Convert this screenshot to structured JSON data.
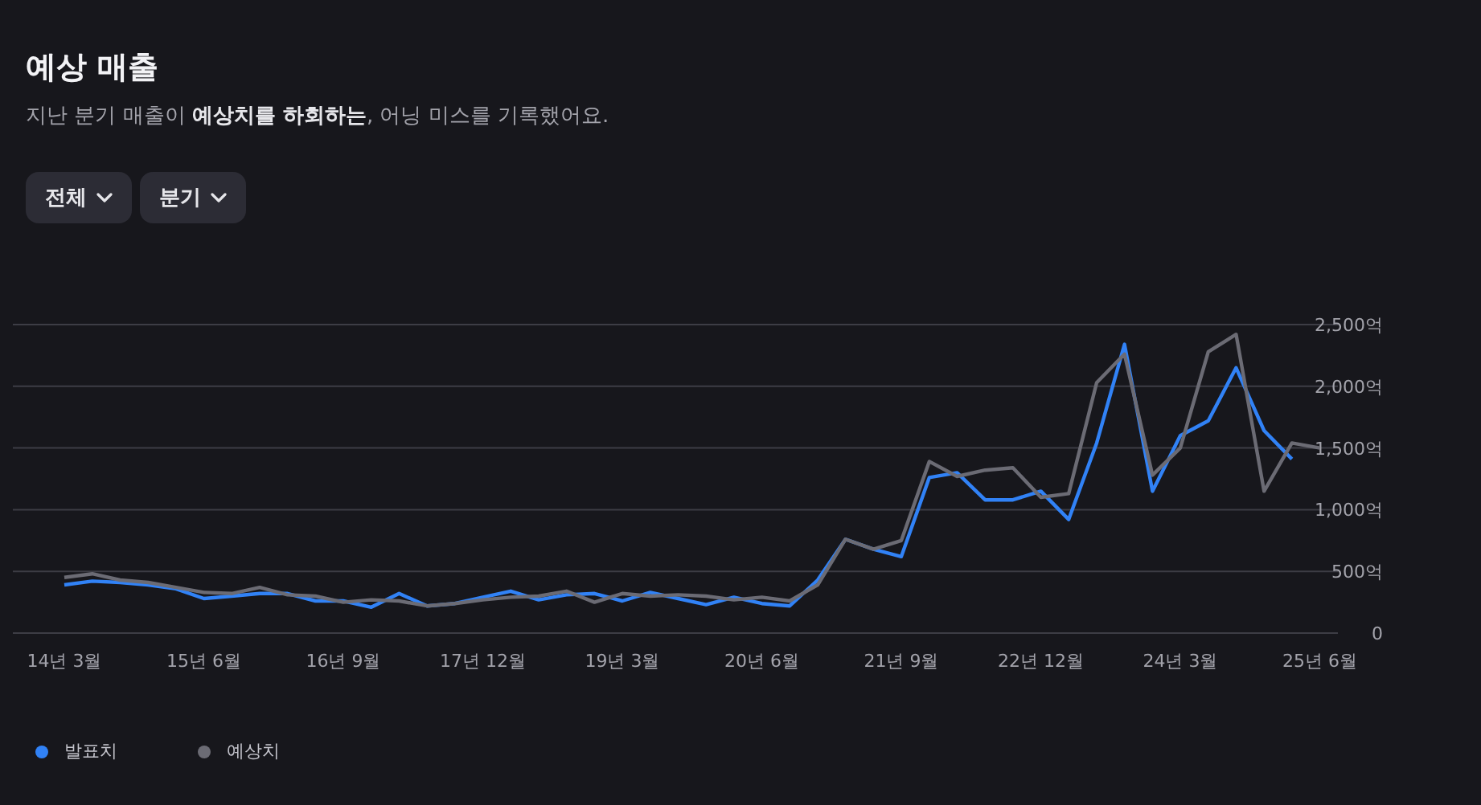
{
  "title": "예상 매출",
  "subtitle": "지난 분기 매출이 **예상치를 하회하는**, 어닝 미스를 기록했어요.",
  "filters": [
    {
      "label": "전체"
    },
    {
      "label": "분기"
    }
  ],
  "chart": {
    "chart_data": {
      "type": "line",
      "categories": [
        "14년 3월",
        null,
        null,
        null,
        null,
        "15년 6월",
        null,
        null,
        null,
        null,
        "16년 9월",
        null,
        null,
        null,
        null,
        "17년 12월",
        null,
        null,
        null,
        null,
        "19년 3월",
        null,
        null,
        null,
        null,
        "20년 6월",
        null,
        null,
        null,
        null,
        "21년 9월",
        null,
        null,
        null,
        null,
        "22년 12월",
        null,
        null,
        null,
        null,
        "24년 3월",
        null,
        null,
        null,
        null,
        "25년 6월"
      ],
      "series": [
        {
          "name": "발표치",
          "color": "#3182f6",
          "values": [
            390,
            420,
            410,
            390,
            360,
            280,
            300,
            320,
            320,
            260,
            260,
            210,
            320,
            220,
            240,
            290,
            340,
            270,
            310,
            320,
            260,
            330,
            280,
            230,
            290,
            240,
            220,
            430,
            760,
            680,
            620,
            1260,
            1300,
            1080,
            1080,
            1150,
            920,
            1540,
            2340,
            1150,
            1600,
            1720,
            2150,
            1640,
            1410,
            null
          ]
        },
        {
          "name": "예상치",
          "color": "#6b6b74",
          "values": [
            450,
            480,
            430,
            410,
            370,
            330,
            320,
            370,
            310,
            300,
            250,
            270,
            260,
            220,
            240,
            270,
            290,
            300,
            340,
            250,
            320,
            300,
            310,
            300,
            270,
            290,
            260,
            390,
            760,
            680,
            750,
            1390,
            1270,
            1320,
            1340,
            1100,
            1130,
            2030,
            2260,
            1280,
            1500,
            2280,
            2420,
            1150,
            1540,
            1500
          ]
        }
      ],
      "yticks": [
        {
          "value": 0,
          "label": "0"
        },
        {
          "value": 500,
          "label": "500억"
        },
        {
          "value": 1000,
          "label": "1,000억"
        },
        {
          "value": 1500,
          "label": "1,500억"
        },
        {
          "value": 2000,
          "label": "2,000억"
        },
        {
          "value": 2500,
          "label": "2,500억"
        }
      ],
      "ylim": [
        0,
        2500
      ],
      "grid": true
    }
  }
}
